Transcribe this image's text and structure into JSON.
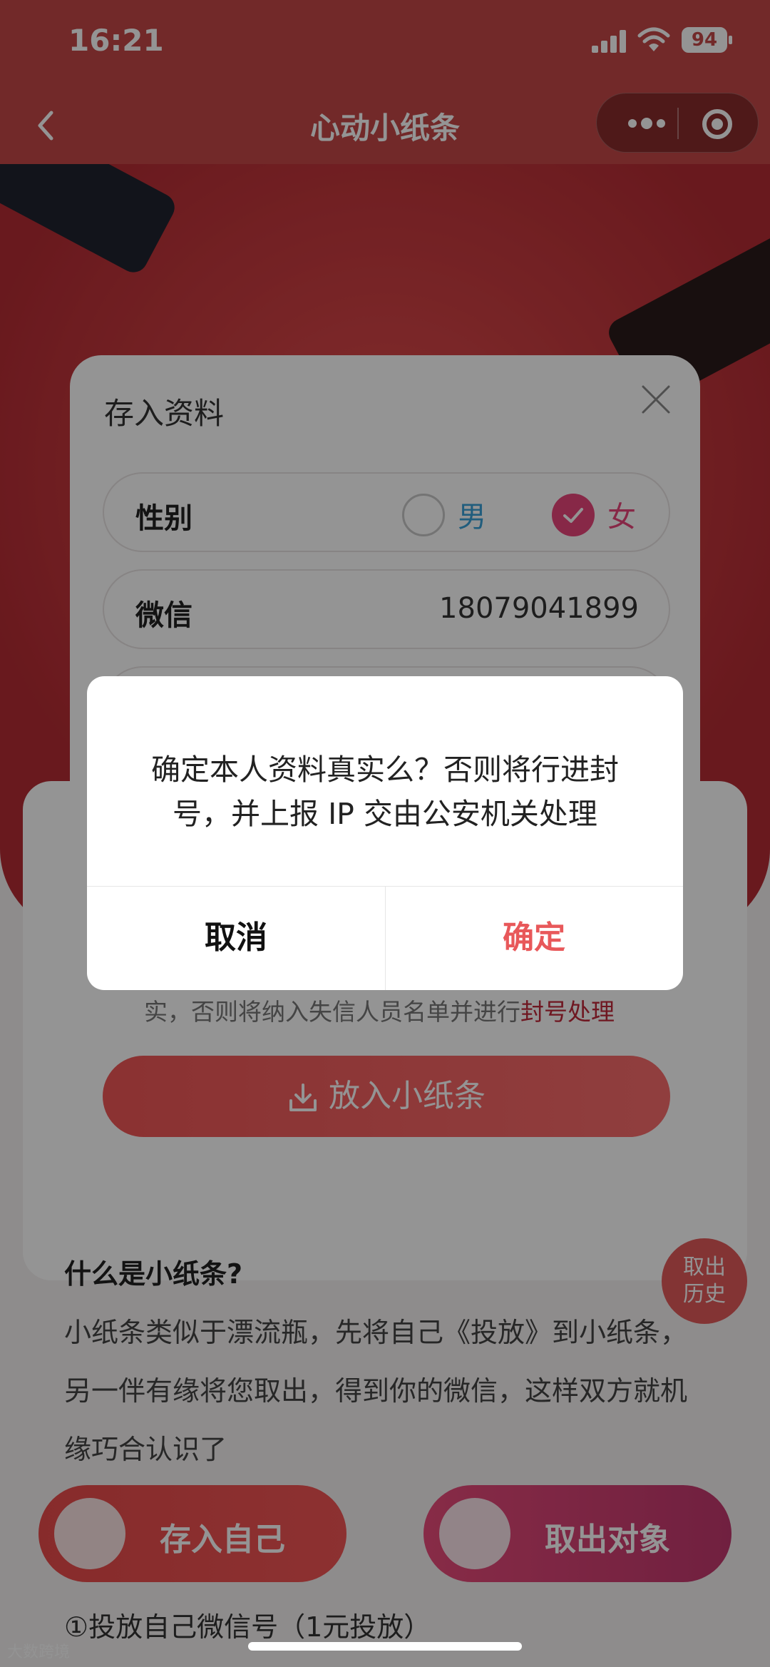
{
  "status_bar": {
    "time": "16:21",
    "battery": "94"
  },
  "nav": {
    "title": "心动小纸条"
  },
  "form": {
    "title": "存入资料",
    "gender_label": "性别",
    "male_label": "男",
    "female_label": "女",
    "female_selected": true,
    "wechat_label": "微信",
    "wechat_value": "18079041899",
    "warning_text": "实，否则将纳入失信人员名单并进行",
    "warning_highlight": "封号处理",
    "submit_label": "放入小纸条"
  },
  "info": {
    "title": "什么是小纸条?",
    "body": "小纸条类似于漂流瓶，先将自己《投放》到小纸条，另一伴有缘将您取出，得到你的微信，这样双方就机缘巧合认识了"
  },
  "float_button": {
    "line1": "取出",
    "line2": "历史"
  },
  "quick_actions": {
    "store_label": "存入自己",
    "take_label": "取出对象"
  },
  "step1": "①投放自己微信号（1元投放）",
  "watermark": "大数跨境",
  "dialog": {
    "message": "确定本人资料真实么？否则将行进封号，并上报 IP 交由公安机关处理",
    "cancel_label": "取消",
    "confirm_label": "确定"
  },
  "colors": {
    "brand_red": "#c44848",
    "accent_pink": "#e8457a",
    "confirm_red": "#e8585a"
  }
}
